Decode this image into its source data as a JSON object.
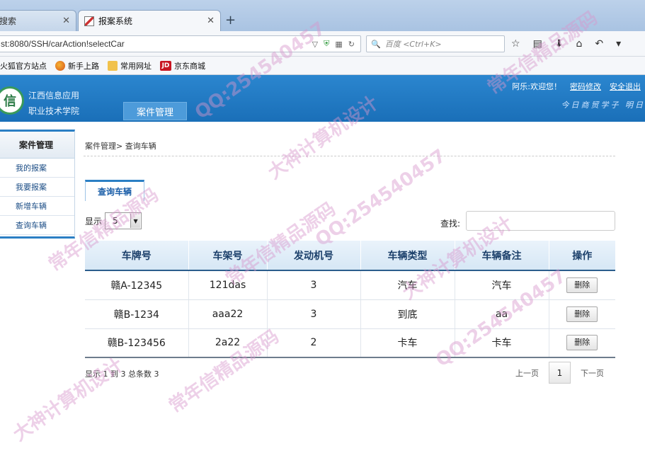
{
  "browser": {
    "tabs": [
      {
        "label": "搜索",
        "active": false
      },
      {
        "label": "报案系统",
        "active": true
      }
    ],
    "url": "st:8080/SSH/carAction!selectCar",
    "search_placeholder": "百度 <Ctrl+K>",
    "bookmarks": [
      "火狐官方站点",
      "新手上路",
      "常用网址",
      "京东商城"
    ]
  },
  "header": {
    "school_line1": "江西信息应用",
    "school_line2": "职业技术学院",
    "logo_char": "信",
    "module_tab": "案件管理",
    "welcome": "阿乐:欢迎您！",
    "change_password": "密码修改",
    "logout": "安全退出",
    "slogan": "今日商贸学子    明日"
  },
  "sidebar": {
    "title": "案件管理",
    "items": [
      "我的报案",
      "我要报案",
      "新增车辆",
      "查询车辆"
    ]
  },
  "main": {
    "breadcrumb": "案件管理> 查询车辆",
    "tab_label": "查询车辆",
    "show_label": "显示",
    "page_size": "5",
    "search_label": "查找:",
    "columns": [
      "车牌号",
      "车架号",
      "发动机号",
      "车辆类型",
      "车辆备注",
      "操作"
    ],
    "rows": [
      {
        "plate": "赣A-12345",
        "frame": "121das",
        "engine": "3",
        "type": "汽车",
        "note": "汽车",
        "action": "删除"
      },
      {
        "plate": "赣B-1234",
        "frame": "aaa22",
        "engine": "3",
        "type": "到底",
        "note": "aa",
        "action": "删除"
      },
      {
        "plate": "赣B-123456",
        "frame": "2a22",
        "engine": "2",
        "type": "卡车",
        "note": "卡车",
        "action": "删除"
      }
    ],
    "info": "显示 1 到 3 总条数 3",
    "prev": "上一页",
    "page": "1",
    "next": "下一页"
  },
  "watermark": {
    "texts": [
      "QQ:254540457",
      "大神计算机设计",
      "常年信精品源码"
    ]
  },
  "colors": {
    "header_blue": "#1a6fb8",
    "accent": "#2b7fc4"
  }
}
